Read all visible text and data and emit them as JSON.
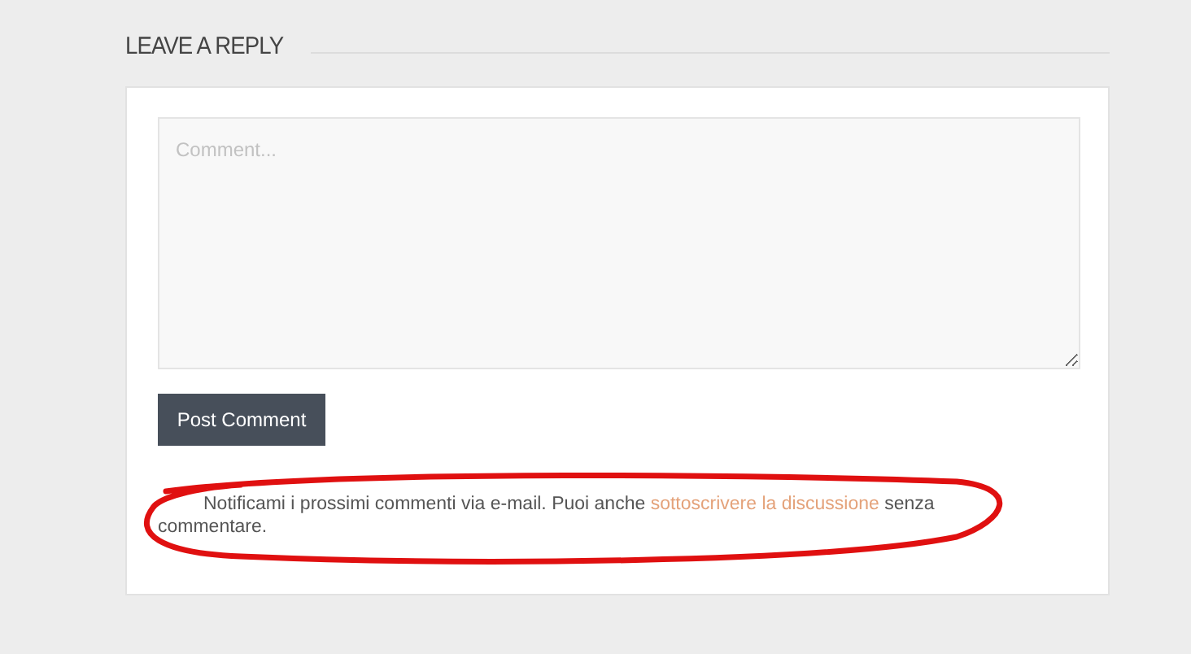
{
  "heading": "LEAVE A REPLY",
  "comment_field": {
    "placeholder": "Comment..."
  },
  "submit_button": "Post Comment",
  "notice": {
    "text_before": "Notificami i prossimi commenti via e-mail. Puoi anche ",
    "link": "sottoscrivere la discussione",
    "text_after": " senza commentare."
  }
}
